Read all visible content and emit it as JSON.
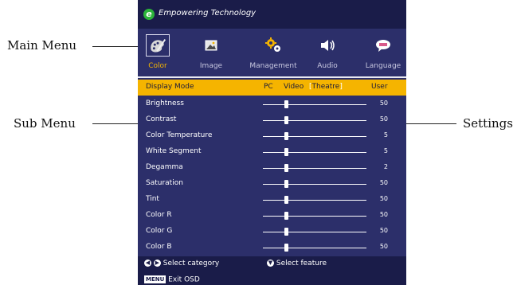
{
  "callouts": {
    "main_menu": "Main Menu",
    "sub_menu": "Sub Menu",
    "settings": "Settings"
  },
  "osd": {
    "brand_logo": "e",
    "brand": "Empowering Technology",
    "main_menu": [
      {
        "label": "Color",
        "icon": "palette-icon",
        "active": true
      },
      {
        "label": "Image",
        "icon": "picture-icon",
        "active": false
      },
      {
        "label": "Management",
        "icon": "gears-icon",
        "active": false
      },
      {
        "label": "Audio",
        "icon": "speaker-icon",
        "active": false
      },
      {
        "label": "Language",
        "icon": "speech-bubble-icon",
        "active": false
      }
    ],
    "display_mode": {
      "label": "Display Mode",
      "options": [
        "PC",
        "Video",
        "Theatre",
        "User"
      ],
      "selected": "Theatre"
    },
    "settings": [
      {
        "label": "Brightness",
        "value": "50",
        "level": 0.23
      },
      {
        "label": "Contrast",
        "value": "50",
        "level": 0.23
      },
      {
        "label": "Color Temperature",
        "value": "5",
        "level": 0.23
      },
      {
        "label": "White Segment",
        "value": "5",
        "level": 0.23
      },
      {
        "label": "Degamma",
        "value": "2",
        "level": 0.23
      },
      {
        "label": "Saturation",
        "value": "50",
        "level": 0.23
      },
      {
        "label": "Tint",
        "value": "50",
        "level": 0.23
      },
      {
        "label": "Color R",
        "value": "50",
        "level": 0.23
      },
      {
        "label": "Color G",
        "value": "50",
        "level": 0.23
      },
      {
        "label": "Color B",
        "value": "50",
        "level": 0.23
      }
    ],
    "footer": {
      "left_right_hint": "Select category",
      "down_hint": "Select feature",
      "menu_key": "MENU",
      "exit_hint": "Exit OSD"
    }
  },
  "colors": {
    "osd_background": "#2c2f6a",
    "header_background": "#1a1c49",
    "highlight": "#f5b400",
    "text": "#ffffff"
  }
}
